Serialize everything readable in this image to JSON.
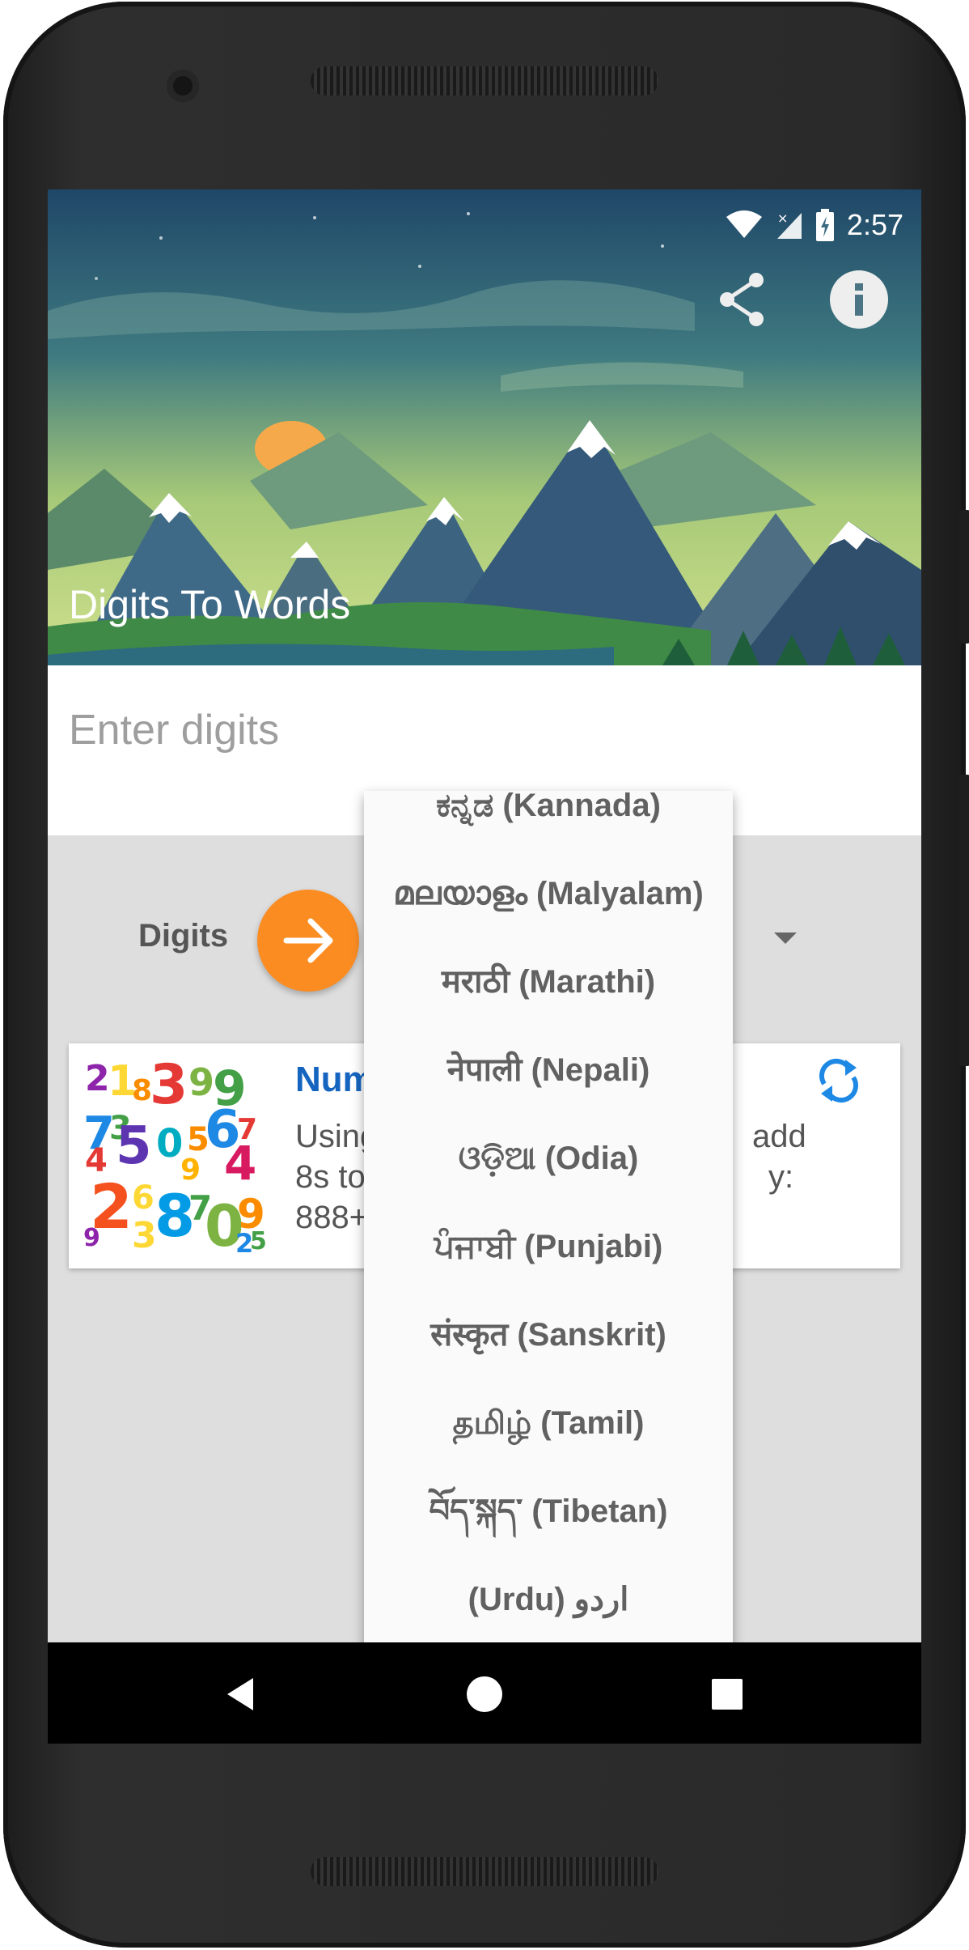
{
  "status_bar": {
    "time": "2:57"
  },
  "app": {
    "title": "Digits To Words"
  },
  "input": {
    "placeholder": "Enter digits",
    "value": ""
  },
  "converter": {
    "from_label": "Digits"
  },
  "card": {
    "title": "Num",
    "text_lines": [
      "Using",
      "8s to",
      "888+"
    ],
    "text_right_lines": [
      "add",
      "y:"
    ]
  },
  "dropdown": {
    "options": [
      "ಕನ್ನಡ (Kannada)",
      "മലയാളം (Malyalam)",
      "मराठी (Marathi)",
      "नेपाली (Nepali)",
      "ଓଡ଼ିଆ (Odia)",
      "ਪੰਜਾਬੀ (Punjabi)",
      "संस्कृत (Sanskrit)",
      "தமிழ் (Tamil)",
      "བོད་སྐད་ (Tibetan)",
      "(Urdu) اردو"
    ]
  },
  "icons": {
    "share": "share-icon",
    "info": "info-icon",
    "arrow": "arrow-right-icon",
    "refresh": "refresh-icon",
    "back": "back-icon",
    "home": "home-icon",
    "recents": "recents-icon"
  },
  "colors": {
    "accent": "#fb8c22",
    "card_title": "#1565c0",
    "background": "#dedede"
  }
}
